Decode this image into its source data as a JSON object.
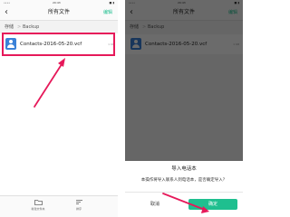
{
  "accent_color": "#1fbf8f",
  "highlight_color": "#e6195a",
  "statusbar": {
    "carrier": "•••• ",
    "time": "20:43",
    "battery": "■ ▮"
  },
  "header": {
    "back_icon": "back-chevron-icon",
    "title": "所有文件",
    "edit_label": "编辑"
  },
  "breadcrumb": {
    "root": "存储",
    "separator": ">",
    "folder": "Backup"
  },
  "files": [
    {
      "name": "Contacts-2016-05-20.vcf",
      "size": "1 KB",
      "icon": "contact-file-icon"
    }
  ],
  "bottom_bar": [
    {
      "label": "新建文件夹",
      "icon": "new-folder-icon"
    },
    {
      "label": "排序",
      "icon": "sort-icon"
    }
  ],
  "import_dialog": {
    "title": "导入电话本",
    "message": "本操作将导入联系人到电话本，是否确定导入？",
    "cancel_label": "取消",
    "confirm_label": "确定"
  }
}
